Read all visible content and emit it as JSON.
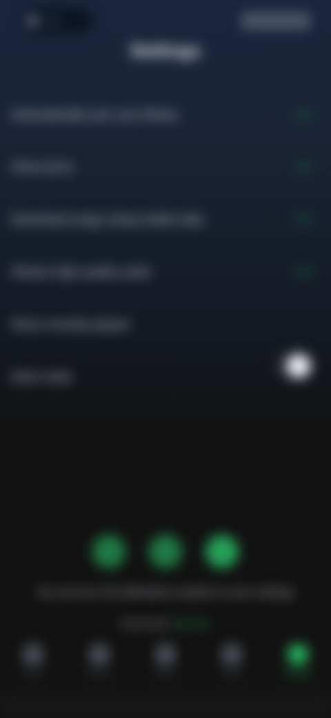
{
  "status": {
    "left_chip": "Live",
    "right_chip": "Settings"
  },
  "page": {
    "title": "Settings"
  },
  "options": [
    {
      "label": "Automatically sync your library"
    },
    {
      "label": "Show lyrics"
    },
    {
      "label": "Download songs using mobile data"
    },
    {
      "label": "Stream high quality audio"
    },
    {
      "label": "Show recently played"
    }
  ],
  "toggle_row": {
    "label": "Dark mode",
    "enabled": true
  },
  "paging": {
    "caption": "You can turn off notifications anytime in your settings",
    "link_prefix": "Need help?",
    "link_text": "Tap here"
  },
  "tabbar": {
    "items": [
      {
        "label": "Home",
        "icon": "home-icon",
        "active": false
      },
      {
        "label": "Search",
        "icon": "search-icon",
        "active": false
      },
      {
        "label": "Library",
        "icon": "library-icon",
        "active": false
      },
      {
        "label": "Profile",
        "icon": "profile-icon",
        "active": false
      },
      {
        "label": "Settings",
        "icon": "settings-icon",
        "active": true
      }
    ]
  },
  "colors": {
    "accent": "#27b460",
    "background": "#121212"
  }
}
